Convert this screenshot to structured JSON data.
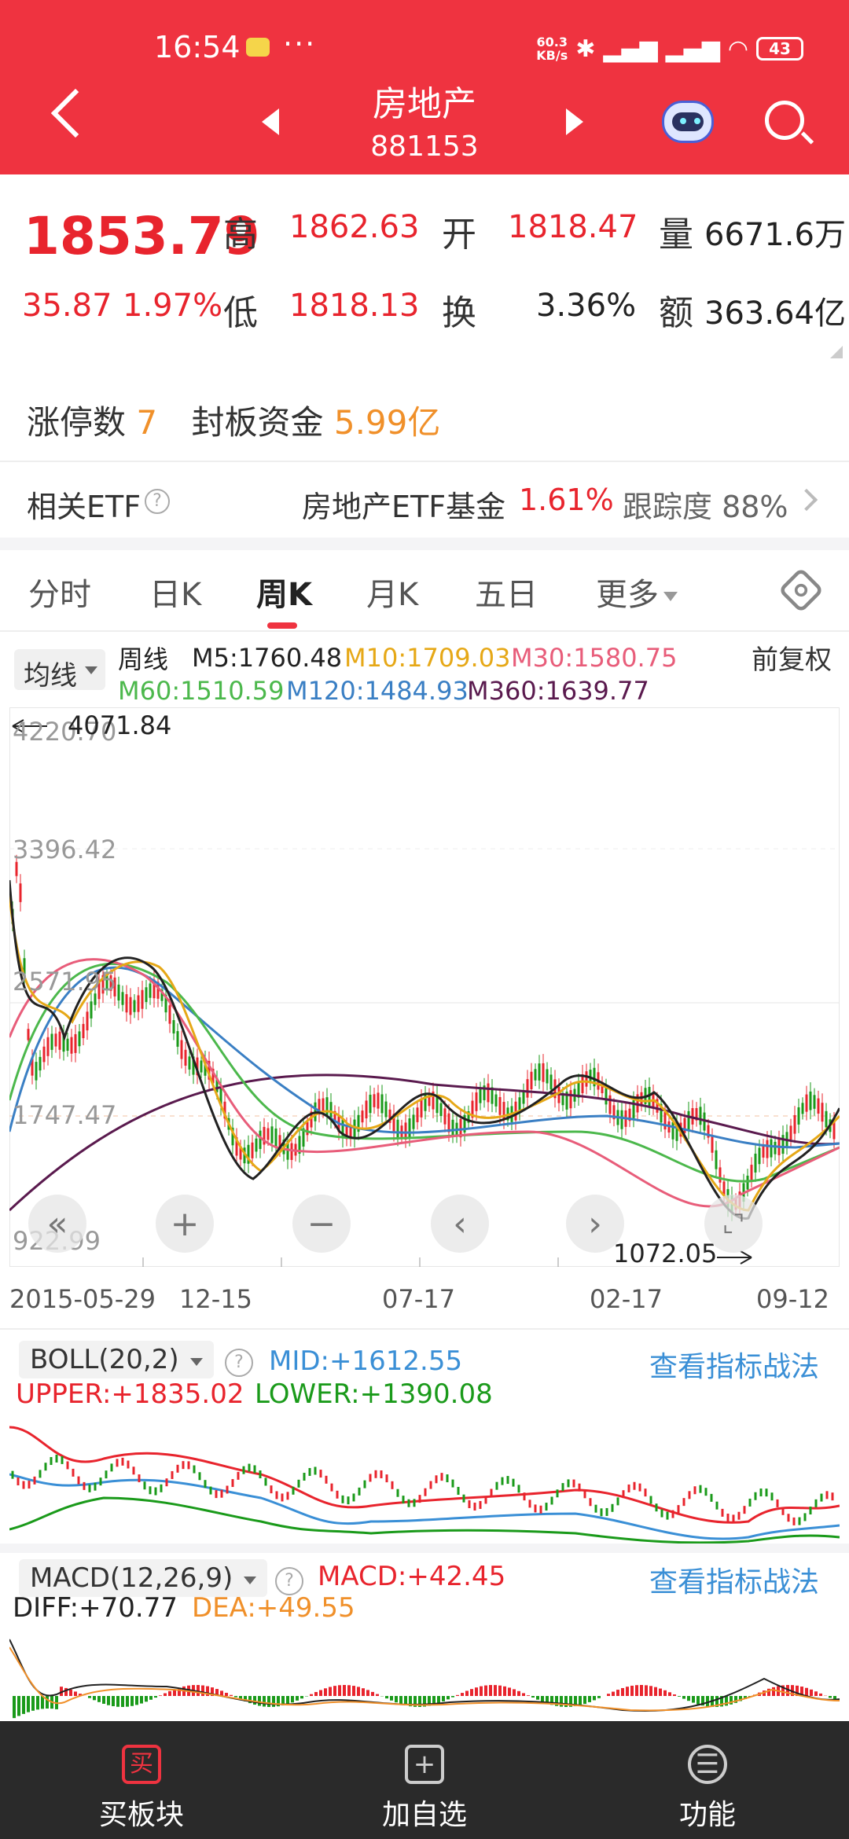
{
  "status": {
    "time": "16:54",
    "dots": "···",
    "speed_top": "60.3",
    "speed_bottom": "KB/s",
    "battery": "43"
  },
  "nav": {
    "title": "房地产",
    "code": "881153"
  },
  "quote": {
    "price": "1853.79",
    "change": "35.87",
    "change_pct": "1.97%",
    "high_label": "高",
    "high": "1862.63",
    "open_label": "开",
    "open": "1818.47",
    "volume_label": "量",
    "volume": "6671.6万",
    "low_label": "低",
    "low": "1818.13",
    "turnover_label": "换",
    "turnover": "3.36%",
    "amount_label": "额",
    "amount": "363.64亿"
  },
  "limit": {
    "count_label": "涨停数",
    "count": "7",
    "fund_label": "封板资金",
    "fund": "5.99亿"
  },
  "etf": {
    "label": "相关ETF",
    "help": "?",
    "name": "房地产ETF基金",
    "pct": "1.61%",
    "track": "跟踪度 88%"
  },
  "tabs": [
    {
      "label": "分时"
    },
    {
      "label": "日K"
    },
    {
      "label": "周K"
    },
    {
      "label": "月K"
    },
    {
      "label": "五日"
    },
    {
      "label": "更多"
    }
  ],
  "ma_legend": {
    "select": "均线",
    "period": "周线",
    "m5": "M5:1760.48",
    "m10": "M10:1709.03",
    "m30": "M30:1580.75",
    "m60": "M60:1510.59",
    "m120": "M120:1484.93",
    "m360": "M360:1639.77",
    "fuquan": "前复权"
  },
  "chart_labels": {
    "y_top": "4220.70",
    "y_2": "3396.42",
    "y_3": "2571.95",
    "y_4": "1747.47",
    "y_bottom": "922.99",
    "max_note": "4071.84",
    "min_note": "1072.05",
    "x_1": "2015-05-29",
    "x_2": "12-15",
    "x_3": "07-17",
    "x_4": "02-17",
    "x_5": "09-12"
  },
  "chart_controls": {
    "collapse": "«",
    "zoom_in": "+",
    "zoom_out": "−",
    "prev": "‹",
    "next": "›"
  },
  "boll": {
    "select": "BOLL(20,2)",
    "help": "?",
    "mid": "MID:+1612.55",
    "upper": "UPPER:+1835.02",
    "lower": "LOWER:+1390.08",
    "link": "查看指标战法"
  },
  "macd": {
    "select": "MACD(12,26,9)",
    "help": "?",
    "macd": "MACD:+42.45",
    "diff": "DIFF:+70.77",
    "dea": "DEA:+49.55",
    "link": "查看指标战法"
  },
  "bottom_bar": {
    "buy_icon": "买",
    "buy": "买板块",
    "add_icon": "+",
    "add": "加自选",
    "func_icon": "☰",
    "func": "功能"
  }
}
